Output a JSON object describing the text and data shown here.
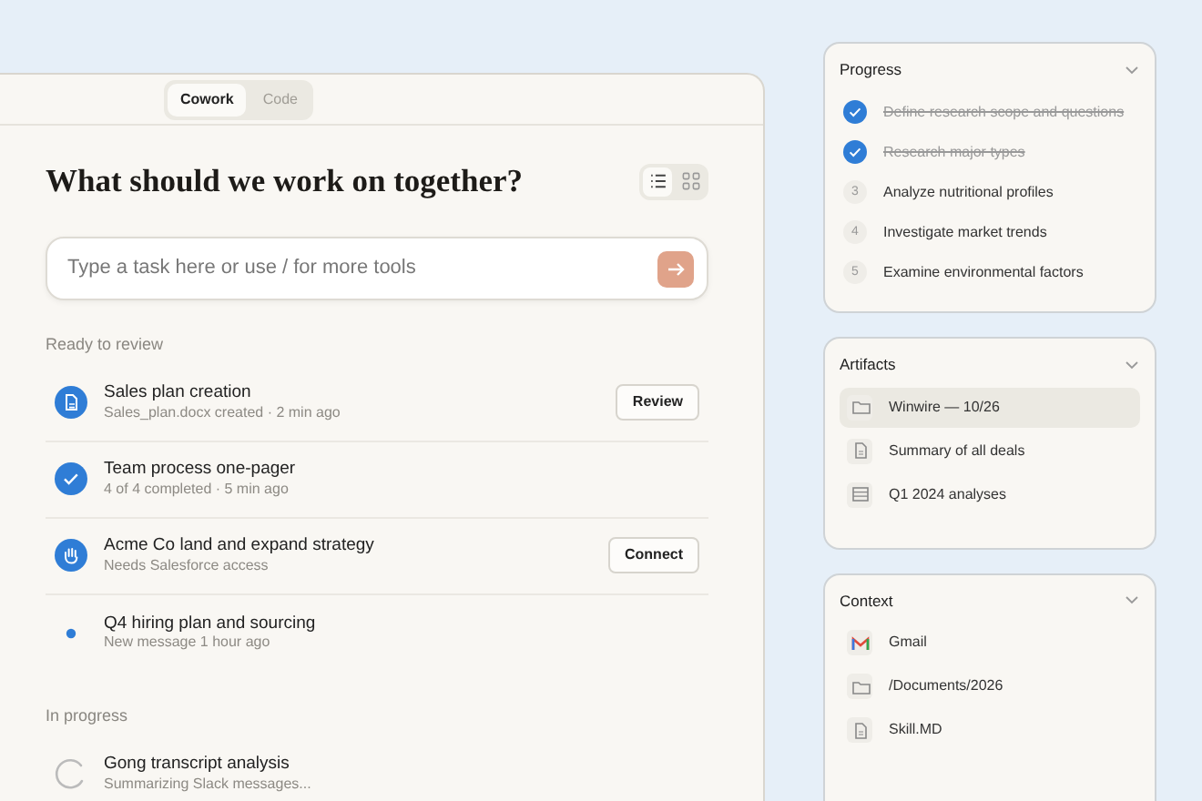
{
  "mode_tabs": [
    {
      "label": "Cowork",
      "selected": true
    },
    {
      "label": "Code",
      "selected": false
    }
  ],
  "title": "What should we work on together?",
  "view_toggle": [
    {
      "kind": "list",
      "selected": true
    },
    {
      "kind": "grid",
      "selected": false
    }
  ],
  "task_input": {
    "placeholder": "Type a task here or use / for more tools"
  },
  "sections": [
    {
      "heading": "Ready to review",
      "tasks": [
        {
          "kind": "file",
          "title": "Sales plan creation",
          "subtitle": "Sales_plan.docx created · 2 min ago",
          "action": "Review"
        },
        {
          "kind": "done",
          "title": "Team process one-pager",
          "subtitle": "4 of 4 completed · 5 min ago"
        },
        {
          "kind": "connect",
          "title": "Acme Co land and expand strategy",
          "subtitle": "Needs Salesforce access",
          "action": "Connect"
        },
        {
          "kind": "message",
          "title": "Q4 hiring plan and sourcing",
          "subtitle": "New message 1 hour ago"
        }
      ]
    },
    {
      "heading": "In progress",
      "tasks": [
        {
          "kind": "loading",
          "title": "Gong transcript analysis",
          "subtitle": "Summarizing Slack messages..."
        }
      ]
    }
  ],
  "progress": {
    "title": "Progress",
    "steps": [
      {
        "label": "Define research scope and questions",
        "done": true
      },
      {
        "label": "Research major types",
        "done": true
      },
      {
        "number": "3",
        "label": "Analyze nutritional profiles",
        "done": false
      },
      {
        "number": "4",
        "label": "Investigate market trends",
        "done": false
      },
      {
        "number": "5",
        "label": "Examine environmental factors",
        "done": false
      }
    ]
  },
  "artifacts": {
    "title": "Artifacts",
    "items": [
      {
        "kind": "folder",
        "label": "Winwire — 10/26",
        "selected": true
      },
      {
        "kind": "document",
        "label": "Summary of all deals",
        "selected": false
      },
      {
        "kind": "table",
        "label": "Q1 2024 analyses",
        "selected": false
      }
    ]
  },
  "context": {
    "title": "Context",
    "items": [
      {
        "kind": "mail",
        "label": "Gmail"
      },
      {
        "kind": "folder",
        "label": "/Documents/2026"
      },
      {
        "kind": "document",
        "label": "Skill.MD"
      }
    ]
  }
}
